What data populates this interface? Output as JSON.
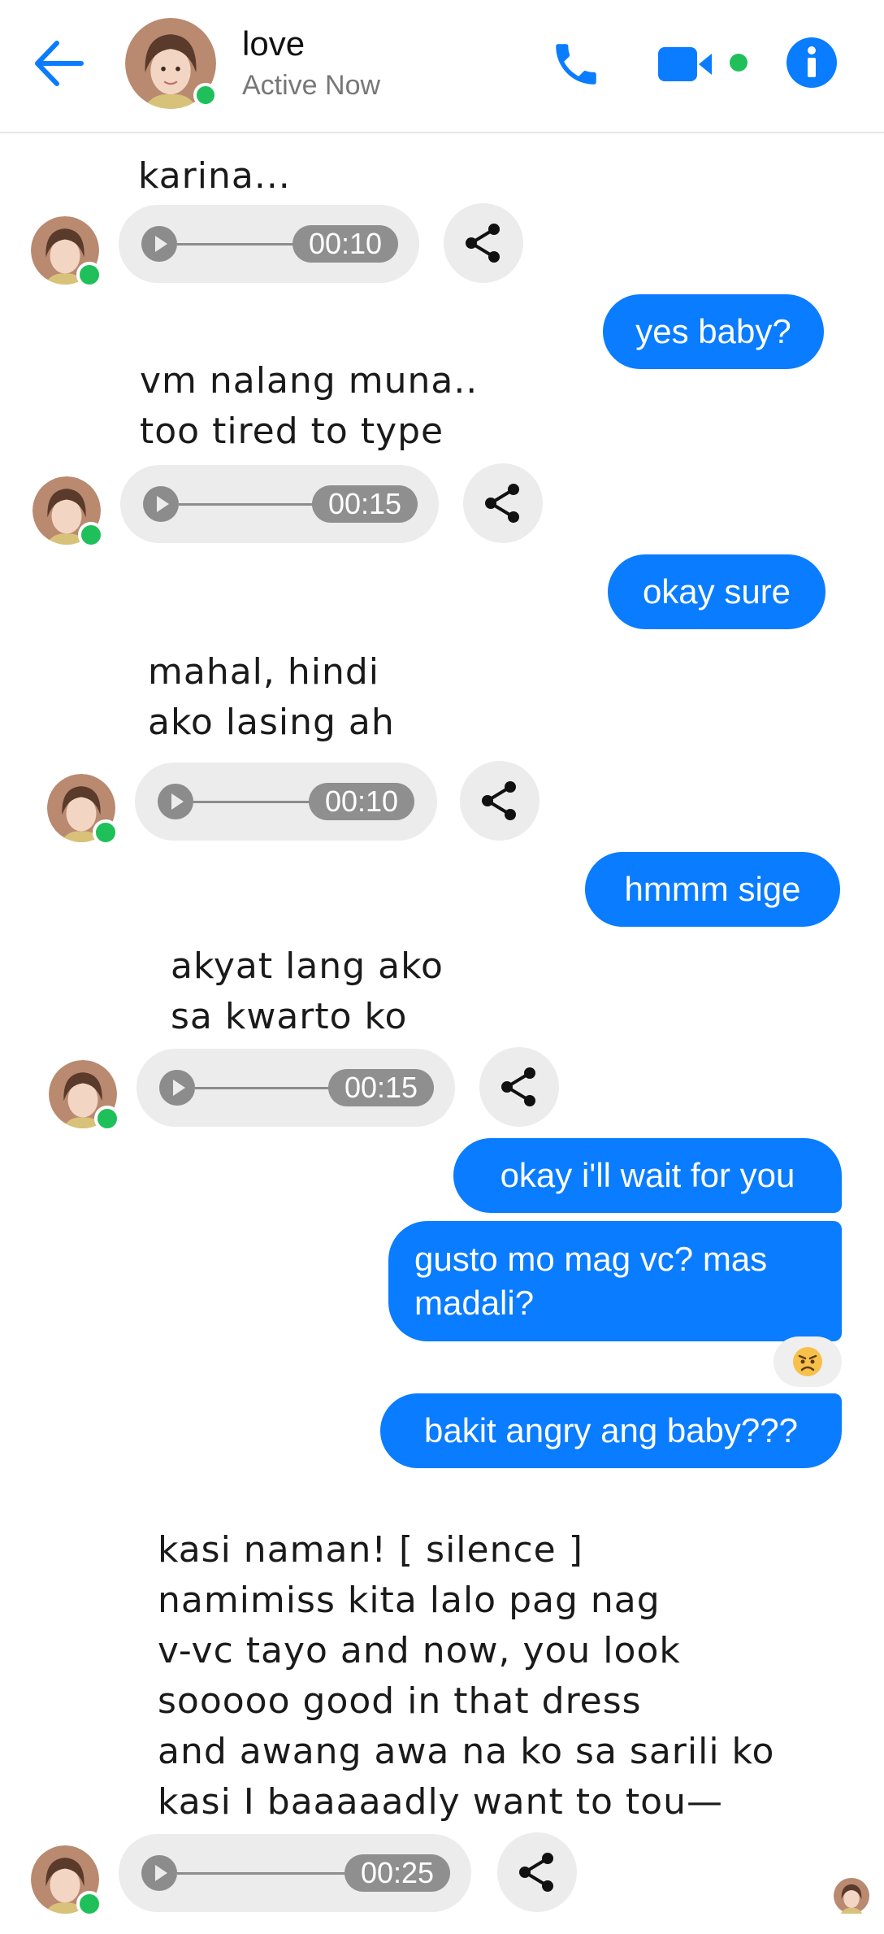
{
  "header": {
    "name": "love",
    "status": "Active Now"
  },
  "messages": [
    {
      "from": "them",
      "caption": "karina...",
      "voice_duration": "00:10"
    },
    {
      "from": "me",
      "text": "yes baby?"
    },
    {
      "from": "them",
      "caption": "vm nalang muna..\ntoo tired to type",
      "voice_duration": "00:15"
    },
    {
      "from": "me",
      "text": "okay sure"
    },
    {
      "from": "them",
      "caption": "mahal, hindi\nako lasing ah",
      "voice_duration": "00:10"
    },
    {
      "from": "me",
      "text": "hmmm sige"
    },
    {
      "from": "them",
      "caption": "akyat lang ako\nsa kwarto ko",
      "voice_duration": "00:15"
    },
    {
      "from": "me",
      "text": "okay i'll wait for you"
    },
    {
      "from": "me",
      "text": "gusto mo mag vc? mas madali?",
      "reaction": "angry-face"
    },
    {
      "from": "me",
      "text": "bakit angry ang baby???"
    },
    {
      "from": "them",
      "caption": "kasi naman! [ silence ]\nnamimiss kita lalo pag nag\nv-vc tayo and now, you look\nsooooo good in that dress\nand awang awa na ko sa sarili ko\nkasi I baaaaadly want to tou—",
      "voice_duration": "00:25"
    }
  ],
  "colors": {
    "accent": "#0a7cff",
    "online": "#1fc05a",
    "voice_bg": "#ececec",
    "voice_fg": "#8f8f8f"
  },
  "icons": [
    "back-arrow-icon",
    "phone-icon",
    "video-camera-icon",
    "info-icon",
    "play-icon",
    "share-icon",
    "angry-face-icon"
  ]
}
